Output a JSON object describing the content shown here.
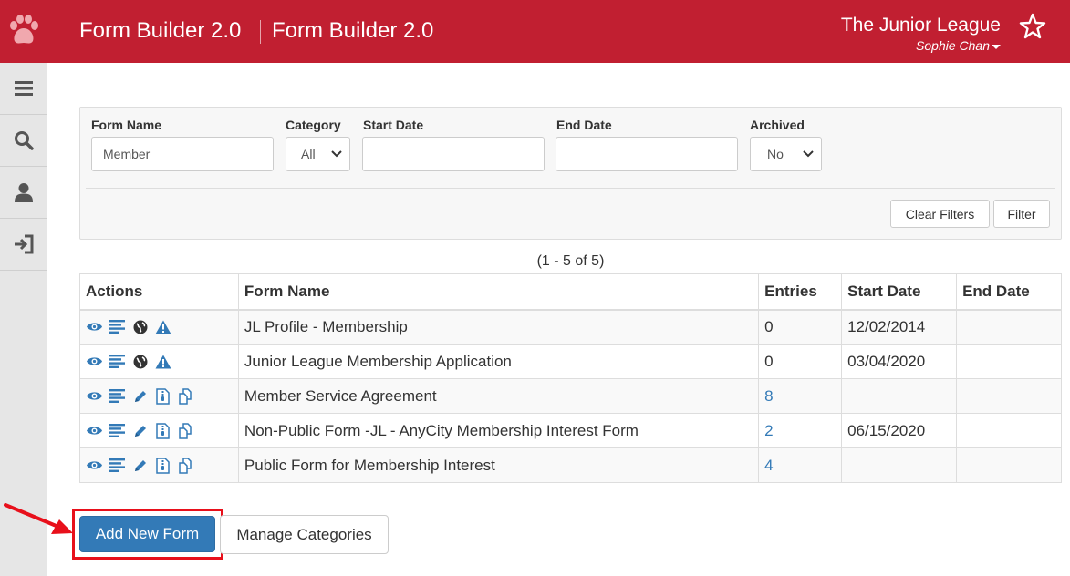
{
  "header": {
    "app_title_1": "Form Builder 2.0",
    "app_title_2": "Form Builder 2.0",
    "org_name": "The Junior League",
    "user_name": "Sophie Chan",
    "brand_color": "#c11f31",
    "logo_icon": "paw-icon",
    "favorite_icon": "star-icon"
  },
  "sidebar": {
    "items": [
      {
        "icon": "menu-icon"
      },
      {
        "icon": "search-icon"
      },
      {
        "icon": "user-icon"
      },
      {
        "icon": "sign-out-icon"
      }
    ]
  },
  "filters": {
    "form_name_label": "Form Name",
    "form_name_value": "Member",
    "category_label": "Category",
    "category_value": "All",
    "start_date_label": "Start Date",
    "start_date_value": "",
    "end_date_label": "End Date",
    "end_date_value": "",
    "archived_label": "Archived",
    "archived_value": "No",
    "clear_label": "Clear Filters",
    "filter_label": "Filter"
  },
  "results": {
    "count_text": "(1 - 5 of 5)",
    "columns": [
      "Actions",
      "Form Name",
      "Entries",
      "Start Date",
      "End Date"
    ],
    "rows": [
      {
        "actions": [
          "view-icon",
          "entries-list-icon",
          "globe-icon",
          "warning-icon"
        ],
        "form_name": "JL Profile - Membership",
        "entries": "0",
        "entries_link": false,
        "start_date": "12/02/2014",
        "end_date": ""
      },
      {
        "actions": [
          "view-icon",
          "entries-list-icon",
          "globe-icon",
          "warning-icon"
        ],
        "form_name": "Junior League Membership Application",
        "entries": "0",
        "entries_link": false,
        "start_date": "03/04/2020",
        "end_date": ""
      },
      {
        "actions": [
          "view-icon",
          "entries-list-icon",
          "edit-icon",
          "archive-icon",
          "copy-icon"
        ],
        "form_name": "Member Service Agreement",
        "entries": "8",
        "entries_link": true,
        "start_date": "",
        "end_date": ""
      },
      {
        "actions": [
          "view-icon",
          "entries-list-icon",
          "edit-icon",
          "archive-icon",
          "copy-icon"
        ],
        "form_name": "Non-Public Form -JL - AnyCity Membership Interest Form",
        "entries": "2",
        "entries_link": true,
        "start_date": "06/15/2020",
        "end_date": ""
      },
      {
        "actions": [
          "view-icon",
          "entries-list-icon",
          "edit-icon",
          "archive-icon",
          "copy-icon"
        ],
        "form_name": "Public Form for Membership Interest",
        "entries": "4",
        "entries_link": true,
        "start_date": "",
        "end_date": ""
      }
    ]
  },
  "footer": {
    "add_label": "Add New Form",
    "manage_label": "Manage Categories",
    "primary_color": "#337ab7",
    "highlight_color": "#e8101b"
  }
}
